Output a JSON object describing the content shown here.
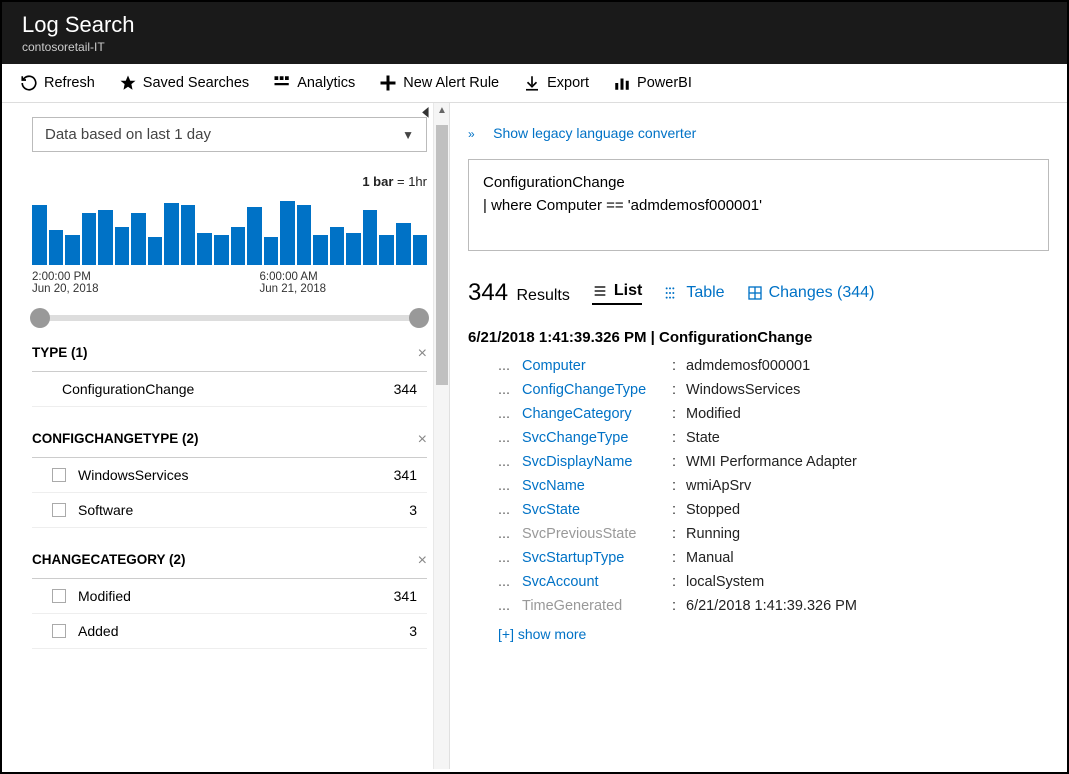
{
  "header": {
    "title": "Log Search",
    "subtitle": "contosoretail-IT"
  },
  "toolbar": {
    "refresh": "Refresh",
    "saved_searches": "Saved Searches",
    "analytics": "Analytics",
    "new_alert": "New Alert Rule",
    "export": "Export",
    "powerbi": "PowerBI"
  },
  "left": {
    "timerange": "Data based on last 1 day",
    "bar_legend_bold": "1 bar",
    "bar_legend_rest": " = 1hr",
    "axis": {
      "left_time": "2:00:00 PM",
      "left_date": "Jun 20, 2018",
      "right_time": "6:00:00 AM",
      "right_date": "Jun 21, 2018"
    },
    "facets": [
      {
        "title": "TYPE  (1)",
        "rows": [
          {
            "label": "ConfigurationChange",
            "count": "344",
            "checkbox": false
          }
        ]
      },
      {
        "title": "CONFIGCHANGETYPE  (2)",
        "rows": [
          {
            "label": "WindowsServices",
            "count": "341",
            "checkbox": true
          },
          {
            "label": "Software",
            "count": "3",
            "checkbox": true
          }
        ]
      },
      {
        "title": "CHANGECATEGORY  (2)",
        "rows": [
          {
            "label": "Modified",
            "count": "341",
            "checkbox": true
          },
          {
            "label": "Added",
            "count": "3",
            "checkbox": true
          }
        ]
      }
    ]
  },
  "right": {
    "converter_link": "Show legacy language converter",
    "query_line1": "ConfigurationChange",
    "query_line2": "| where Computer == 'admdemosf000001'",
    "result_count": "344",
    "result_label": "Results",
    "views": {
      "list": "List",
      "table": "Table",
      "changes": "Changes (344)"
    },
    "record_header": "6/21/2018 1:41:39.326 PM | ConfigurationChange",
    "fields": [
      {
        "key": "Computer",
        "val": "admdemosf000001",
        "gray": false
      },
      {
        "key": "ConfigChangeType",
        "val": "WindowsServices",
        "gray": false
      },
      {
        "key": "ChangeCategory",
        "val": "Modified",
        "gray": false
      },
      {
        "key": "SvcChangeType",
        "val": "State",
        "gray": false
      },
      {
        "key": "SvcDisplayName",
        "val": "WMI Performance Adapter",
        "gray": false
      },
      {
        "key": "SvcName",
        "val": "wmiApSrv",
        "gray": false
      },
      {
        "key": "SvcState",
        "val": "Stopped",
        "gray": false
      },
      {
        "key": "SvcPreviousState",
        "val": "Running",
        "gray": true
      },
      {
        "key": "SvcStartupType",
        "val": "Manual",
        "gray": false
      },
      {
        "key": "SvcAccount",
        "val": "localSystem",
        "gray": false
      },
      {
        "key": "TimeGenerated",
        "val": "6/21/2018 1:41:39.326 PM",
        "gray": true
      }
    ],
    "show_more": "[+] show more"
  },
  "chart_data": {
    "type": "bar",
    "title": "",
    "xlabel": "",
    "ylabel": "",
    "x_range": [
      "Jun 20, 2018 2:00:00 PM",
      "Jun 21, 2018 6:00:00 AM plus"
    ],
    "categories_note": "1 bar = 1hr, ~24 hourly bins",
    "values": [
      60,
      35,
      30,
      52,
      55,
      38,
      52,
      28,
      62,
      60,
      32,
      30,
      38,
      58,
      28,
      64,
      60,
      30,
      38,
      32,
      55,
      30,
      42,
      30
    ],
    "ylim": [
      0,
      70
    ]
  }
}
